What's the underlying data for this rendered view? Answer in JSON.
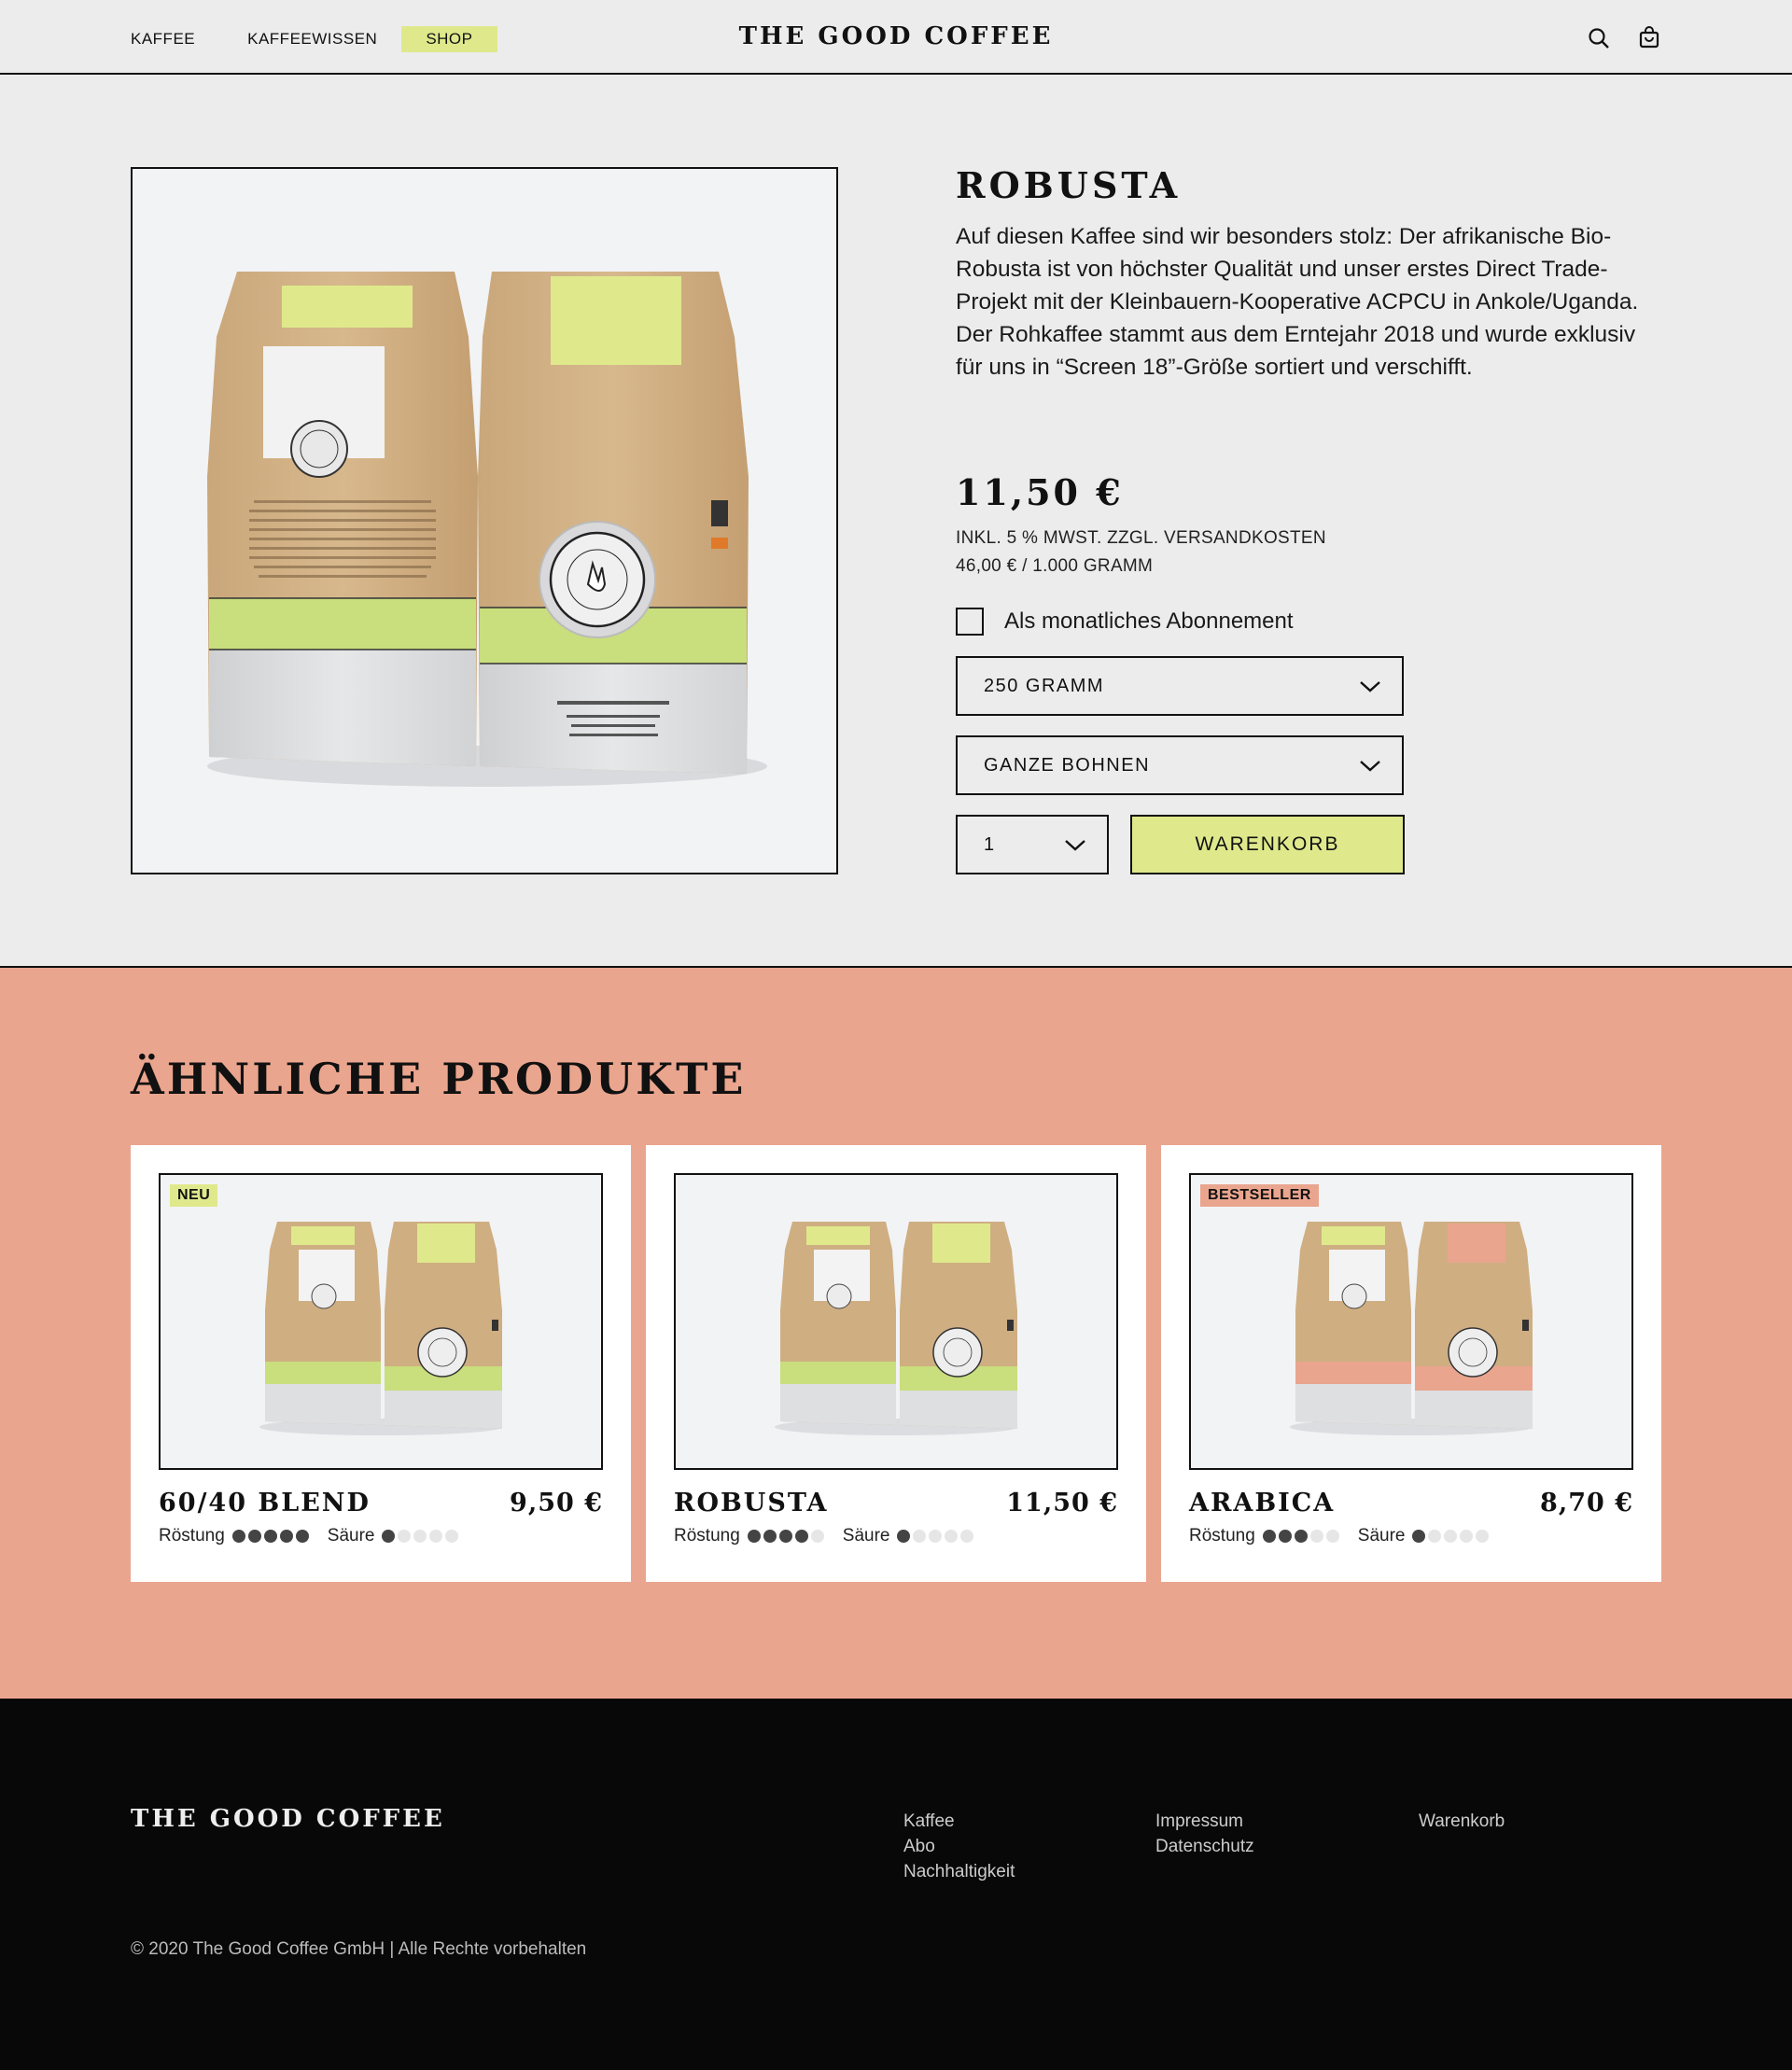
{
  "header": {
    "nav": [
      {
        "label": "KAFFEE"
      },
      {
        "label": "KAFFEEWISSEN"
      },
      {
        "label": "SHOP"
      }
    ],
    "logo": "THE GOOD COFFEE",
    "icons": [
      "search-icon",
      "cart-icon"
    ]
  },
  "product": {
    "title": "ROBUSTA",
    "description": "Auf diesen Kaffee sind wir besonders stolz: Der afrikanische Bio-Robusta ist von höchster Qualität und unser erstes Direct Trade-Projekt mit der Kleinbauern-Kooperative ACPCU in Ankole/Uganda. Der Rohkaffee stammt aus dem Erntejahr 2018 und wurde exklusiv für uns in “Screen 18”-Größe sortiert und verschifft.",
    "price": "11,50 €",
    "tax_note": "INKL. 5 % MWST. ZZGL. VERSANDKOSTEN",
    "unit_price": "46,00 € /  1.000 GRAMM",
    "subscription_label": "Als monatliches Abonnement",
    "subscription_checked": false,
    "size_select": "250 GRAMM",
    "grind_select": "GANZE BOHNEN",
    "quantity_select": "1",
    "cart_button": "WARENKORB",
    "bag_accent": "#c9de7c"
  },
  "similar": {
    "title": "ÄHNLICHE PRODUKTE",
    "roast_label": "Röstung",
    "acid_label": "Säure",
    "items": [
      {
        "name": "60/40 BLEND",
        "price": "9,50 €",
        "badge": "NEU",
        "badge_color": "#dfe98c",
        "roast": 5,
        "acidity": 1,
        "bag_accent": "#c9de7c"
      },
      {
        "name": "ROBUSTA",
        "price": "11,50 €",
        "badge": "",
        "badge_color": "",
        "roast": 4,
        "acidity": 1,
        "bag_accent": "#c9de7c"
      },
      {
        "name": "ARABICA",
        "price": "8,70 €",
        "badge": "BESTSELLER",
        "badge_color": "#eaa58e",
        "roast": 3,
        "acidity": 1,
        "bag_accent": "#eaa58e"
      }
    ]
  },
  "footer": {
    "logo": "THE GOOD COFFEE",
    "col1": [
      "Kaffee",
      "Abo",
      "Nachhaltigkeit"
    ],
    "col2": [
      "Impressum",
      "Datenschutz"
    ],
    "col3": [
      "Warenkorb"
    ],
    "copyright": "© 2020 The Good Coffee GmbH | Alle Rechte vorbehalten"
  },
  "colors": {
    "accent_lime": "#dfe98c",
    "salmon": "#eaa58e",
    "background": "#ececec",
    "footer": "#080808"
  }
}
